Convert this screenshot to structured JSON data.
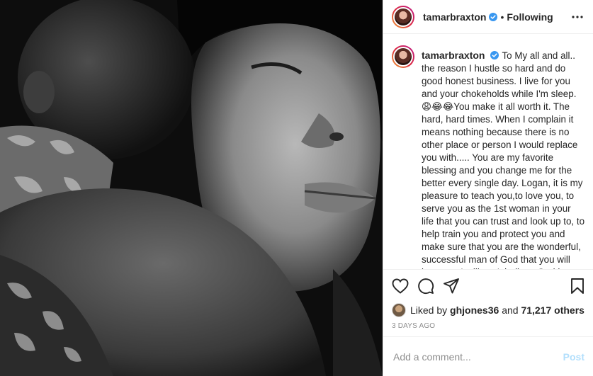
{
  "header": {
    "username": "tamarbraxton",
    "dot": "•",
    "follow_status": "Following",
    "verified_icon": "verified-badge-icon",
    "more_icon": "more-options-icon"
  },
  "caption": {
    "username": "tamarbraxton",
    "text": "To My all and all.. the reason I hustle so hard and do good honest business. I live for you and your chokeholds while I'm sleep.😩😂😂You make it all worth it. The hard, hard times. When I complain it means nothing because there is no other place or person I would replace you with..... You are my favorite blessing and you change me for the better every single day. Logan, it is my pleasure to teach you,to love you, to serve you as the 1st woman in your life that you can trust and look up to, to help train you and protect you and make sure that you are the wonderful, successful man of God that you will become. I still can't believe God loves me so much to trust me with one of his special favorites like you. I'm"
  },
  "actions": {
    "like_icon": "heart-icon",
    "comment_icon": "comment-icon",
    "share_icon": "share-icon",
    "save_icon": "bookmark-icon"
  },
  "likes": {
    "prefix": "Liked by",
    "user": "ghjones36",
    "and": "and",
    "count": "71,217 others"
  },
  "timestamp": "3 DAYS AGO",
  "comment": {
    "placeholder": "Add a comment...",
    "post_label": "Post"
  },
  "colors": {
    "verified": "#3897f0",
    "post_button": "#b2dffc",
    "muted": "#8e8e8e"
  }
}
